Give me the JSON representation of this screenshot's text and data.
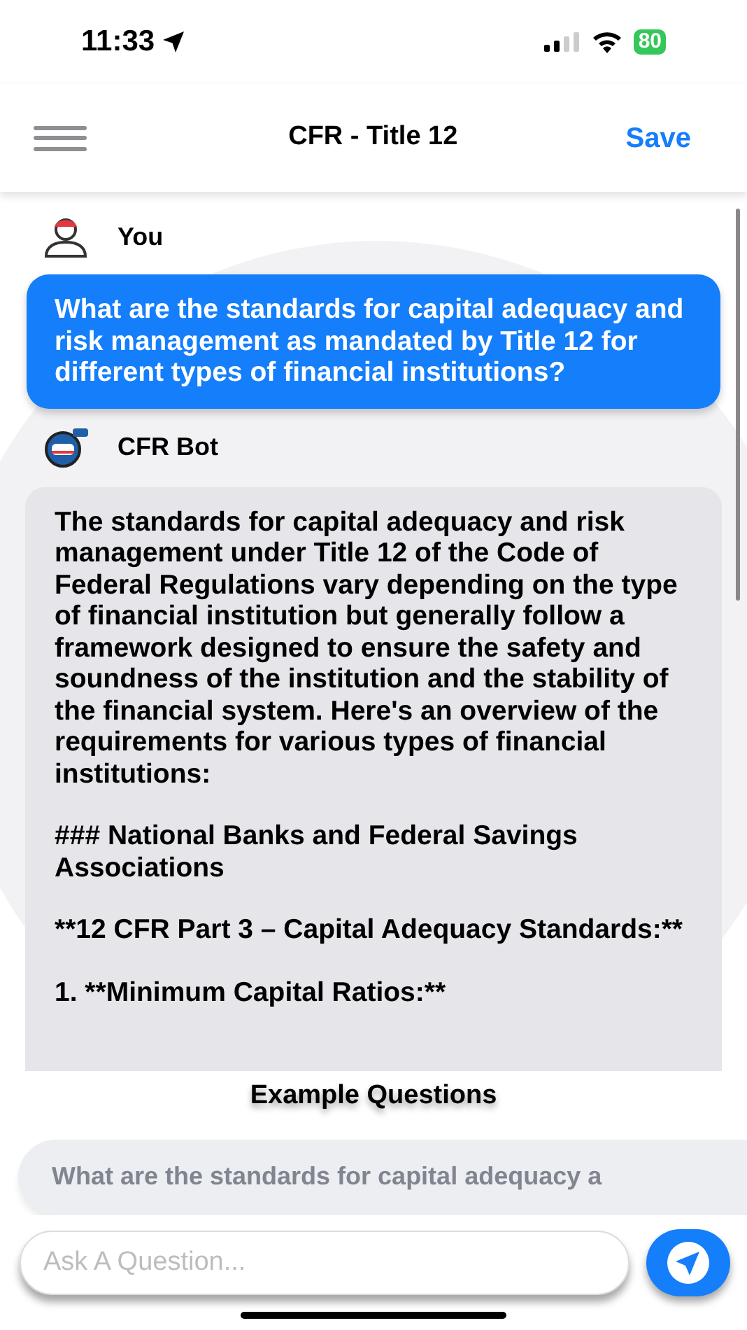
{
  "status_bar": {
    "time": "11:33",
    "battery": "80"
  },
  "nav": {
    "title": "CFR - Title 12",
    "save": "Save"
  },
  "messages": [
    {
      "kind": "user",
      "sender": "You",
      "paragraphs": [
        "What are the standards for capital adequacy and risk management as mandated by Title 12 for different types of financial institutions?"
      ]
    },
    {
      "kind": "bot",
      "sender": "CFR Bot",
      "paragraphs": [
        "The standards for capital adequacy and risk management under Title 12 of the Code of Federal Regulations vary depending on the type of financial institution but generally follow a framework designed to ensure the safety and soundness of the institution and the stability of the financial system. Here's an overview of the requirements for various types of financial institutions:",
        "### National Banks and Federal Savings Associations",
        "**12 CFR Part 3 – Capital Adequacy Standards:**",
        "1. **Minimum Capital Ratios:**"
      ]
    }
  ],
  "examples": {
    "heading": "Example Questions",
    "items": [
      "What are the standards for capital adequacy a"
    ]
  },
  "input": {
    "placeholder": "Ask A Question..."
  }
}
